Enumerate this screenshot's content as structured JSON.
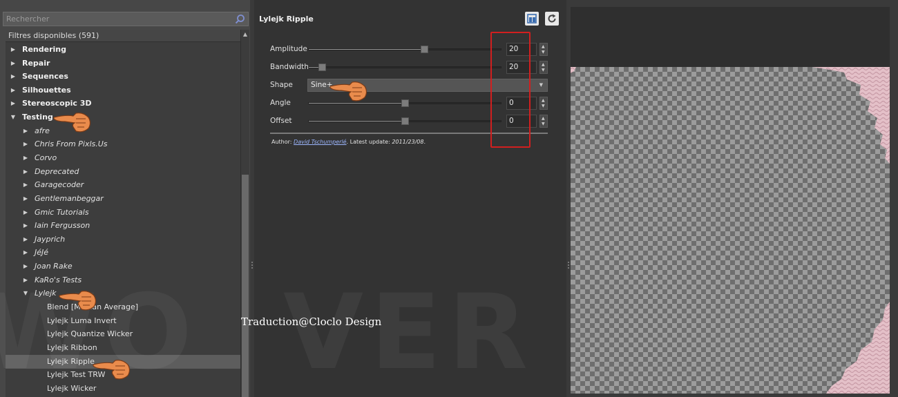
{
  "search": {
    "placeholder": "Rechercher"
  },
  "tree": {
    "header": "Filtres disponibles (591)",
    "categories": [
      "Rendering",
      "Repair",
      "Sequences",
      "Silhouettes",
      "Stereoscopic 3D",
      "Testing"
    ],
    "testing_children": [
      "afre",
      "Chris From Pixls.Us",
      "Corvo",
      "Deprecated",
      "Garagecoder",
      "Gentlemanbeggar",
      "Gmic Tutorials",
      "Iain Fergusson",
      "Jayprich",
      "JéJé",
      "Joan Rake",
      "KaRo's Tests",
      "Lylejk"
    ],
    "lylejk_children": [
      "Blend [Median Average]",
      "Lylejk Luma Invert",
      "Lylejk Quantize Wicker",
      "Lylejk Ribbon",
      "Lylejk Ripple",
      "Lylejk Test TRW",
      "Lylejk Wicker"
    ],
    "selected": "Lylejk Ripple"
  },
  "filter": {
    "title": "Lylejk Ripple",
    "params": {
      "amplitude": {
        "label": "Amplitude",
        "value": "20",
        "fraction": 0.6
      },
      "bandwidth": {
        "label": "Bandwidth",
        "value": "20",
        "fraction": 0.07
      },
      "shape": {
        "label": "Shape",
        "value": "Sine+"
      },
      "angle": {
        "label": "Angle",
        "value": "0",
        "fraction": 0.5
      },
      "offset": {
        "label": "Offset",
        "value": "0",
        "fraction": 0.5
      }
    },
    "author_prefix": "Author: ",
    "author_name": "David Tschumperlé",
    "update_text": ". Latest update: ",
    "update_date": "2011/23/08",
    "update_suffix": "."
  },
  "overlay": {
    "credit": "Traduction@Cloclo Design",
    "watermark_left": "WO",
    "watermark_right": "VER"
  },
  "colors": {
    "highlight_box": "#d21f1f",
    "link": "#9db7ff",
    "texture_pink": "#e4c0c8"
  },
  "icons": {
    "search": "search-icon",
    "layout": "layout-icon",
    "refresh": "refresh-icon",
    "pointer": "pointing-hand-icon"
  }
}
